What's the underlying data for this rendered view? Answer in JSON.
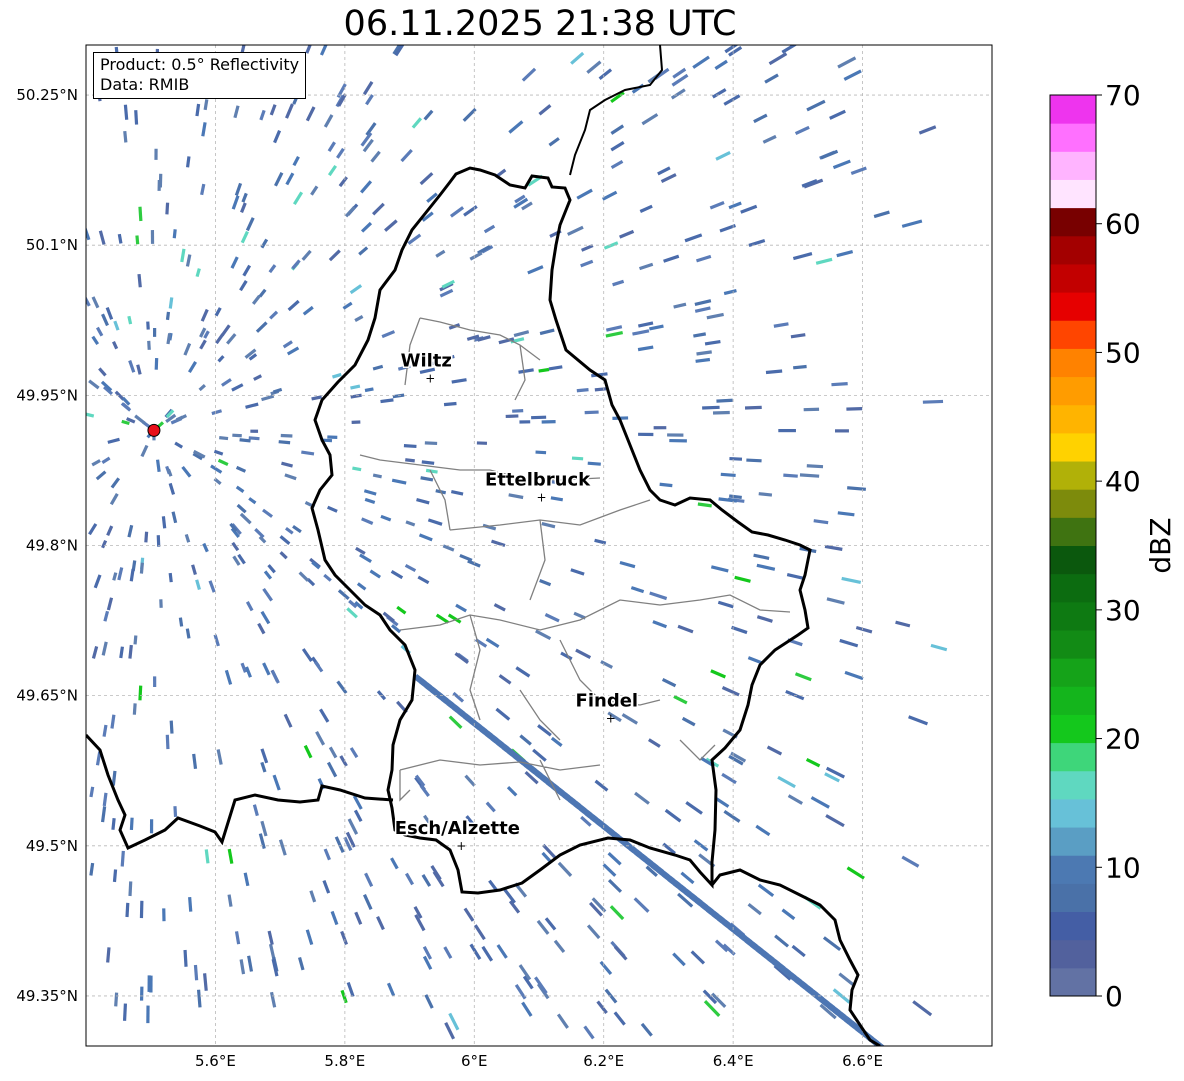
{
  "title": "06.11.2025 21:38 UTC",
  "info": {
    "product": "Product: 0.5° Reflectivity",
    "data": "Data: RMIB"
  },
  "axes": {
    "lon_ticks": [
      {
        "value": 5.6,
        "label": "5.6°E"
      },
      {
        "value": 5.8,
        "label": "5.8°E"
      },
      {
        "value": 6.0,
        "label": "6°E"
      },
      {
        "value": 6.2,
        "label": "6.2°E"
      },
      {
        "value": 6.4,
        "label": "6.4°E"
      },
      {
        "value": 6.6,
        "label": "6.6°E"
      }
    ],
    "lat_ticks": [
      {
        "value": 50.25,
        "label": "50.25°N"
      },
      {
        "value": 50.1,
        "label": "50.1°N"
      },
      {
        "value": 49.95,
        "label": "49.95°N"
      },
      {
        "value": 49.8,
        "label": "49.8°N"
      },
      {
        "value": 49.65,
        "label": "49.65°N"
      },
      {
        "value": 49.5,
        "label": "49.5°N"
      },
      {
        "value": 49.35,
        "label": "49.35°N"
      }
    ],
    "lon_range": [
      5.4,
      6.8
    ],
    "lat_range": [
      49.3,
      50.3
    ]
  },
  "colorbar": {
    "label": "dBZ",
    "min": 0,
    "max": 70,
    "tick_labels": [
      "0",
      "10",
      "20",
      "30",
      "40",
      "50",
      "60",
      "70"
    ],
    "colors": [
      "#6272a4",
      "#52619d",
      "#445ea5",
      "#4a71a8",
      "#4c79b2",
      "#5a9ec4",
      "#67c1d8",
      "#5fd8c0",
      "#3ed67a",
      "#14c81c",
      "#14b51c",
      "#15a319",
      "#128b15",
      "#0e7a12",
      "#0c6c10",
      "#0b580d",
      "#3f7311",
      "#7d8b0c",
      "#b1b108",
      "#ffd200",
      "#ffb400",
      "#ff9c00",
      "#ff8200",
      "#ff4500",
      "#e60000",
      "#c20000",
      "#a30000",
      "#780000",
      "#ffe4ff",
      "#ffb4ff",
      "#ff70ff",
      "#ee34ee"
    ]
  },
  "radar_site": {
    "lon": 5.505,
    "lat": 49.915,
    "color": "#e8101a"
  },
  "cities": [
    {
      "name": "Wiltz",
      "lon": 5.932,
      "lat": 49.967
    },
    {
      "name": "Ettelbruck",
      "lon": 6.104,
      "lat": 49.848
    },
    {
      "name": "Findel",
      "lon": 6.211,
      "lat": 49.627
    },
    {
      "name": "Esch/Alzette",
      "lon": 5.98,
      "lat": 49.5
    }
  ]
}
